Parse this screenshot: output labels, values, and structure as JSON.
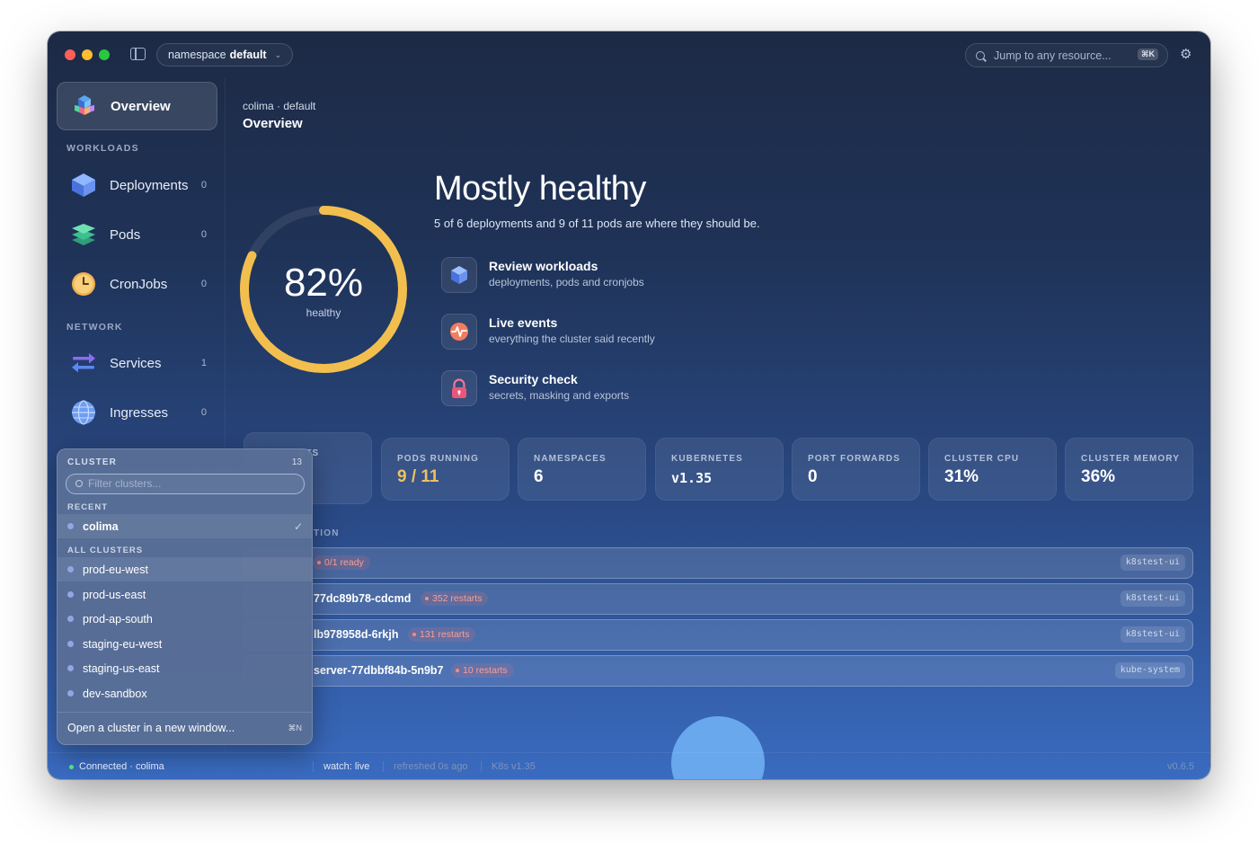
{
  "titlebar": {
    "namespace_prefix": "namespace",
    "namespace_value": "default",
    "search_placeholder": "Jump to any resource...",
    "search_shortcut": "⌘K"
  },
  "sidebar": {
    "overview_label": "Overview",
    "workloads_label": "WORKLOADS",
    "network_label": "NETWORK",
    "items": [
      {
        "label": "Deployments",
        "count": "0",
        "icon": "cube-icon"
      },
      {
        "label": "Pods",
        "count": "0",
        "icon": "layers-icon"
      },
      {
        "label": "CronJobs",
        "count": "0",
        "icon": "clock-icon"
      },
      {
        "label": "Services",
        "count": "1",
        "icon": "arrows-icon"
      },
      {
        "label": "Ingresses",
        "count": "0",
        "icon": "globe-icon"
      }
    ]
  },
  "header": {
    "breadcrumb": "colima · default",
    "title": "Overview"
  },
  "health": {
    "percent": 82,
    "percent_label": "82%",
    "ring_label": "healthy",
    "title": "Mostly healthy",
    "summary": "5 of 6 deployments and 9 of 11 pods are where they should be.",
    "accent_color": "#f2bf4e"
  },
  "actions": [
    {
      "title": "Review workloads",
      "desc": "deployments, pods and cronjobs",
      "icon": "cube-icon"
    },
    {
      "title": "Live events",
      "desc": "everything the cluster said recently",
      "icon": "pulse-icon"
    },
    {
      "title": "Security check",
      "desc": "secrets, masking and exports",
      "icon": "lock-icon"
    }
  ],
  "stats": [
    {
      "label": "PODS RUNNING",
      "value": "9 / 11"
    },
    {
      "label": "NAMESPACES",
      "value": "6"
    },
    {
      "label": "KUBERNETES",
      "value": "v1.35"
    },
    {
      "label": "PORT FORWARDS",
      "value": "0"
    },
    {
      "label": "CLUSTER CPU",
      "value": "31%"
    },
    {
      "label": "CLUSTER MEMORY",
      "value": "36%"
    }
  ],
  "stat_partial_label": "NTS",
  "attention": {
    "label_fragment": "TION",
    "rows": [
      {
        "name": "",
        "badge": "0/1 ready",
        "namespace": "k8stest-ui"
      },
      {
        "name": "77dc89b78-cdcmd",
        "badge": "352 restarts",
        "namespace": "k8stest-ui"
      },
      {
        "name": "lb978958d-6rkjh",
        "badge": "131 restarts",
        "namespace": "k8stest-ui"
      },
      {
        "name": "server-77dbbf84b-5n9b7",
        "badge": "10 restarts",
        "namespace": "kube-system"
      }
    ]
  },
  "cluster_dropdown": {
    "title": "CLUSTER",
    "count": "13",
    "filter_placeholder": "Filter clusters...",
    "recent_label": "RECENT",
    "recent": [
      {
        "name": "colima",
        "selected": true
      }
    ],
    "all_label": "ALL CLUSTERS",
    "all": [
      "prod-eu-west",
      "prod-us-east",
      "prod-ap-south",
      "staging-eu-west",
      "staging-us-east",
      "dev-sandbox"
    ],
    "open_new_window": "Open a cluster in a new window...",
    "open_shortcut": "⌘N"
  },
  "statusbar": {
    "connection": "Connected · colima",
    "watch": "watch: live",
    "refreshed": "refreshed 0s ago",
    "k8s": "K8s v1.35",
    "version": "v0.6.5"
  }
}
